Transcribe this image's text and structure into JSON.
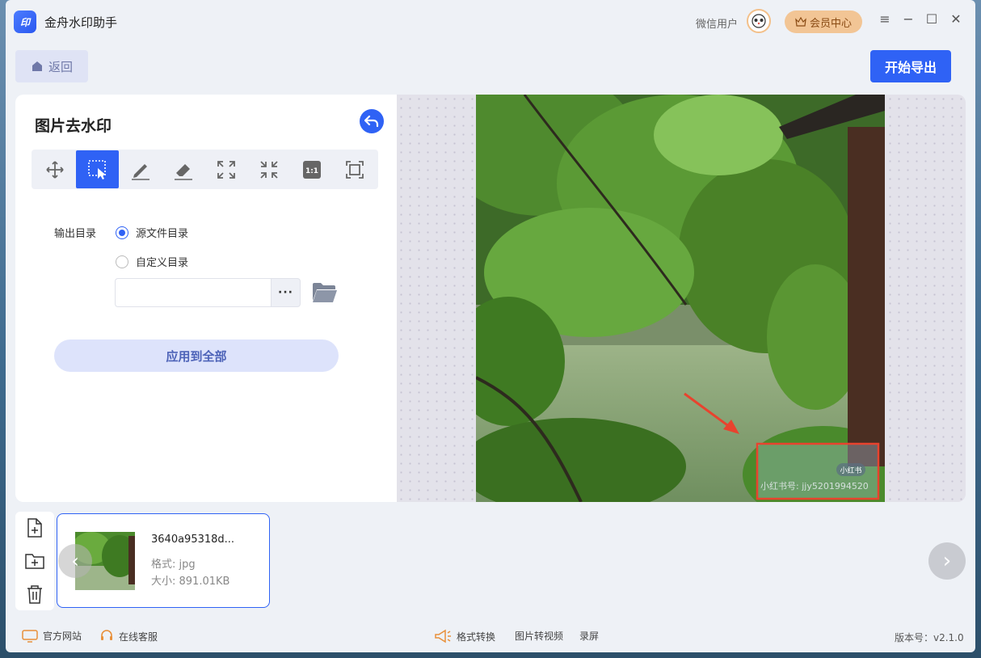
{
  "app": {
    "title": "金舟水印助手",
    "logo_text": "印"
  },
  "header": {
    "user_name": "微信用户",
    "vip_label": "会员中心"
  },
  "toolbar": {
    "back_label": "返回",
    "export_label": "开始导出"
  },
  "panel": {
    "title": "图片去水印",
    "tools": [
      "move-tool",
      "select-tool",
      "brush-tool",
      "eraser-tool",
      "zoom-in-tool",
      "zoom-out-tool",
      "actual-size-tool",
      "fit-screen-tool"
    ],
    "active_tool": "select-tool",
    "actual_size_label": "1:1",
    "output_label": "输出目录",
    "option_source": "源文件目录",
    "option_custom": "自定义目录",
    "path_value": "",
    "browse_label": "···",
    "apply_label": "应用到全部"
  },
  "preview": {
    "watermark_badge": "小红书",
    "watermark_text": "小红书号: jjy5201994520"
  },
  "files": [
    {
      "name": "3640a95318d...",
      "format": "格式: jpg",
      "size": "大小: 891.01KB"
    }
  ],
  "footer": {
    "website": "官方网站",
    "support": "在线客服",
    "format_convert": "格式转换",
    "img_to_video": "图片转视频",
    "record": "录屏",
    "version": "版本号：v2.1.0"
  },
  "colors": {
    "accent": "#2f62f5",
    "vip": "#f2c595",
    "highlight_box": "#e8432e"
  }
}
